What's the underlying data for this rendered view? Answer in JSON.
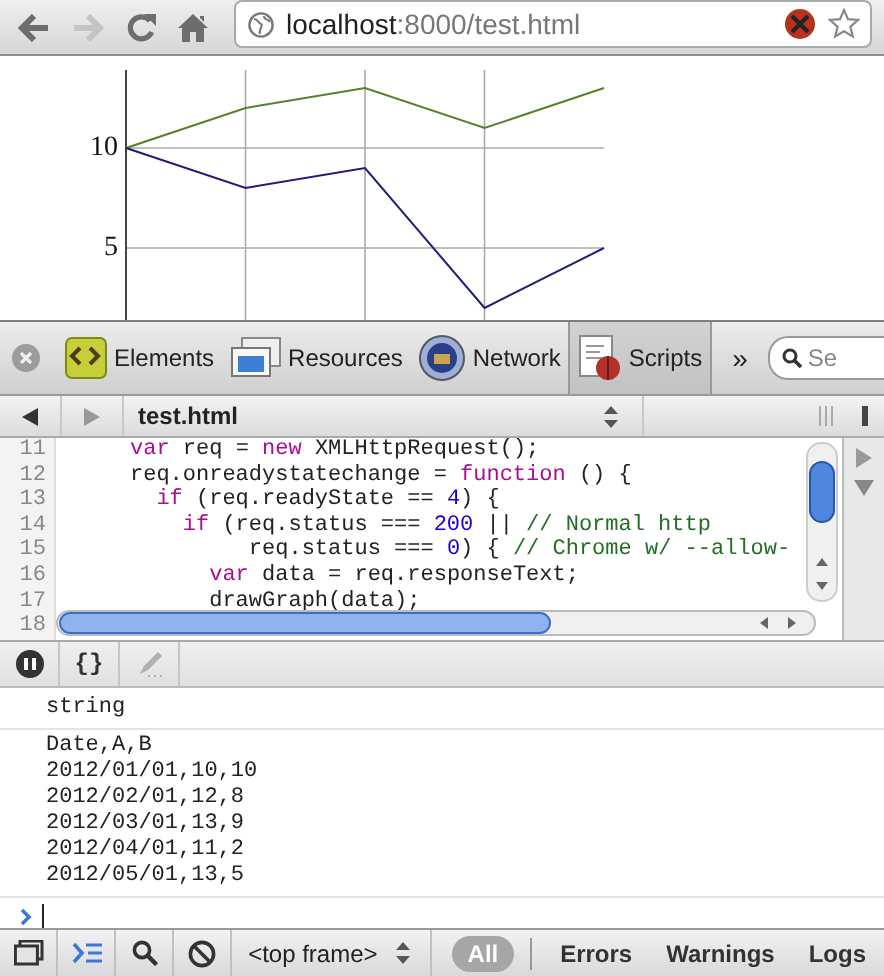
{
  "browser": {
    "nav": [
      {
        "kind": "back",
        "disabled": false
      },
      {
        "kind": "forward",
        "disabled": true
      },
      {
        "kind": "reload",
        "disabled": false
      },
      {
        "kind": "home",
        "disabled": false
      }
    ],
    "url_host": "localhost",
    "url_path": ":8000/test.html"
  },
  "graph": {
    "chart_data": {
      "type": "line",
      "categories": [
        null,
        null,
        null,
        null,
        null
      ],
      "ylim": [
        1.4,
        13.9
      ],
      "yticks": [
        5,
        10
      ],
      "grid": true,
      "series": [
        {
          "color": "#5a7f2a",
          "values": [
            10,
            12,
            13,
            11,
            13
          ]
        },
        {
          "color": "#1e1e78",
          "values": [
            10,
            8,
            9,
            2,
            5
          ]
        }
      ]
    }
  },
  "devtools": {
    "tabs": [
      {
        "kind": "elements",
        "label": "Elements",
        "selected": false
      },
      {
        "kind": "resources",
        "label": "Resources",
        "selected": false
      },
      {
        "kind": "network",
        "label": "Network",
        "selected": false
      },
      {
        "kind": "scripts",
        "label": "Scripts",
        "selected": true
      }
    ],
    "more": "»",
    "search": {
      "placeholder": "Se"
    }
  },
  "scripts": {
    "file": "test.html",
    "code_lines": [
      {
        "number": "11",
        "tokens": [
          {
            "kind": "keyword",
            "text": "var"
          },
          {
            "kind": "plain",
            "text": " req = "
          },
          {
            "kind": "keyword",
            "text": "new"
          },
          {
            "kind": "plain",
            "text": " XMLHttpRequest();"
          }
        ]
      },
      {
        "number": "12",
        "tokens": [
          {
            "kind": "plain",
            "text": "req.onreadystatechange = "
          },
          {
            "kind": "keyword",
            "text": "function"
          },
          {
            "kind": "plain",
            "text": " () {"
          }
        ]
      },
      {
        "number": "13",
        "tokens": [
          {
            "kind": "keyword",
            "text": "  if"
          },
          {
            "kind": "plain",
            "text": " (req.readyState == "
          },
          {
            "kind": "number",
            "text": "4"
          },
          {
            "kind": "plain",
            "text": ") {"
          }
        ]
      },
      {
        "number": "14",
        "tokens": [
          {
            "kind": "keyword",
            "text": "    if"
          },
          {
            "kind": "plain",
            "text": " (req.status === "
          },
          {
            "kind": "number",
            "text": "200"
          },
          {
            "kind": "plain",
            "text": " || "
          },
          {
            "kind": "comment",
            "text": "// Normal http"
          }
        ]
      },
      {
        "number": "15",
        "tokens": [
          {
            "kind": "plain",
            "text": "         req.status === "
          },
          {
            "kind": "number",
            "text": "0"
          },
          {
            "kind": "plain",
            "text": ") { "
          },
          {
            "kind": "comment",
            "text": "// Chrome w/ --allow-"
          }
        ]
      },
      {
        "number": "16",
        "tokens": [
          {
            "kind": "keyword",
            "text": "      var"
          },
          {
            "kind": "plain",
            "text": " data = req.responseText;"
          }
        ]
      },
      {
        "number": "17",
        "tokens": [
          {
            "kind": "plain",
            "text": "      drawGraph(data);"
          }
        ]
      },
      {
        "number": "18"
      }
    ]
  },
  "debugger": {
    "buttons": [
      {
        "kind": "pause",
        "disabled": false
      },
      {
        "kind": "pretty",
        "label": "{}",
        "disabled": false
      },
      {
        "kind": "edit",
        "disabled": true
      }
    ]
  },
  "console": {
    "messages": [
      {
        "lines": [
          "string"
        ]
      },
      {
        "lines": [
          "Date,A,B",
          "2012/01/01,10,10",
          "2012/02/01,12,8",
          "2012/03/01,13,9",
          "2012/04/01,11,2",
          "2012/05/01,13,5"
        ]
      }
    ]
  },
  "console_bar": {
    "buttons": [
      {
        "kind": "dock",
        "selected": false
      },
      {
        "kind": "console",
        "selected": true
      },
      {
        "kind": "search",
        "selected": false
      },
      {
        "kind": "clear",
        "selected": false
      }
    ],
    "frame": "<top frame>",
    "filters": [
      {
        "label": "All",
        "selected": true
      },
      {
        "label": "Errors",
        "selected": false
      },
      {
        "label": "Warnings",
        "selected": false
      },
      {
        "label": "Logs",
        "selected": false
      }
    ]
  }
}
